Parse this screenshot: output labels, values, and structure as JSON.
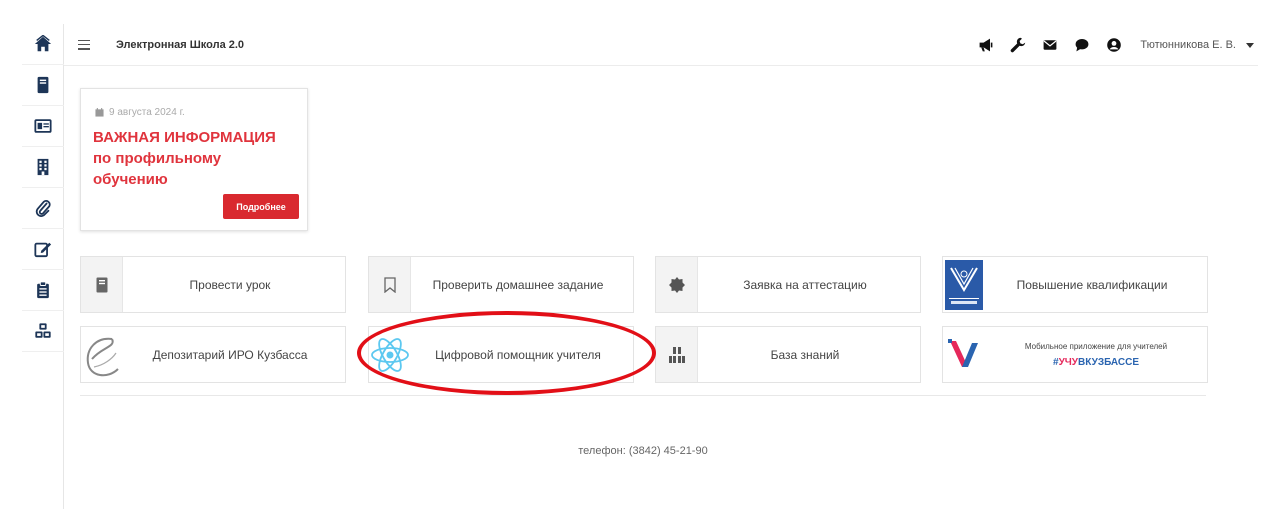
{
  "header": {
    "app_title": "Электронная Школа 2.0",
    "user_name": "Тютюнникова Е. В."
  },
  "sidebar": {
    "items": [
      {
        "icon": "home-icon"
      },
      {
        "icon": "book-icon"
      },
      {
        "icon": "card-icon"
      },
      {
        "icon": "building-icon"
      },
      {
        "icon": "paperclip-icon"
      },
      {
        "icon": "edit-icon"
      },
      {
        "icon": "clipboard-icon"
      },
      {
        "icon": "cubes-icon"
      }
    ]
  },
  "top_icons": [
    "megaphone-icon",
    "wrench-icon",
    "envelope-icon",
    "comment-icon",
    "user-icon"
  ],
  "news": {
    "date": "9 августа 2024 г.",
    "title": "ВАЖНАЯ ИНФОРМАЦИЯ по профильному обучению",
    "button_label": "Подробнее"
  },
  "tiles": {
    "lesson": "Провести урок",
    "homework": "Проверить домашнее задание",
    "attestation": "Заявка на аттестацию",
    "qualification": "Повышение квалификации",
    "depository": "Депозитарий ИРО Кузбасса",
    "assistant": "Цифровой помощник учителя",
    "knowledge": "База знаний",
    "app_line1": "Мобильное приложение для учителей",
    "app_hash": "#",
    "app_part1": "УЧУ",
    "app_part2": "ВКУЗБАССЕ"
  },
  "footer": {
    "phone": "телефон: (3842) 45-21-90"
  },
  "colors": {
    "accent_red": "#d9292f",
    "sidebar_icon": "#1d3557",
    "highlight": "#e20f17"
  }
}
